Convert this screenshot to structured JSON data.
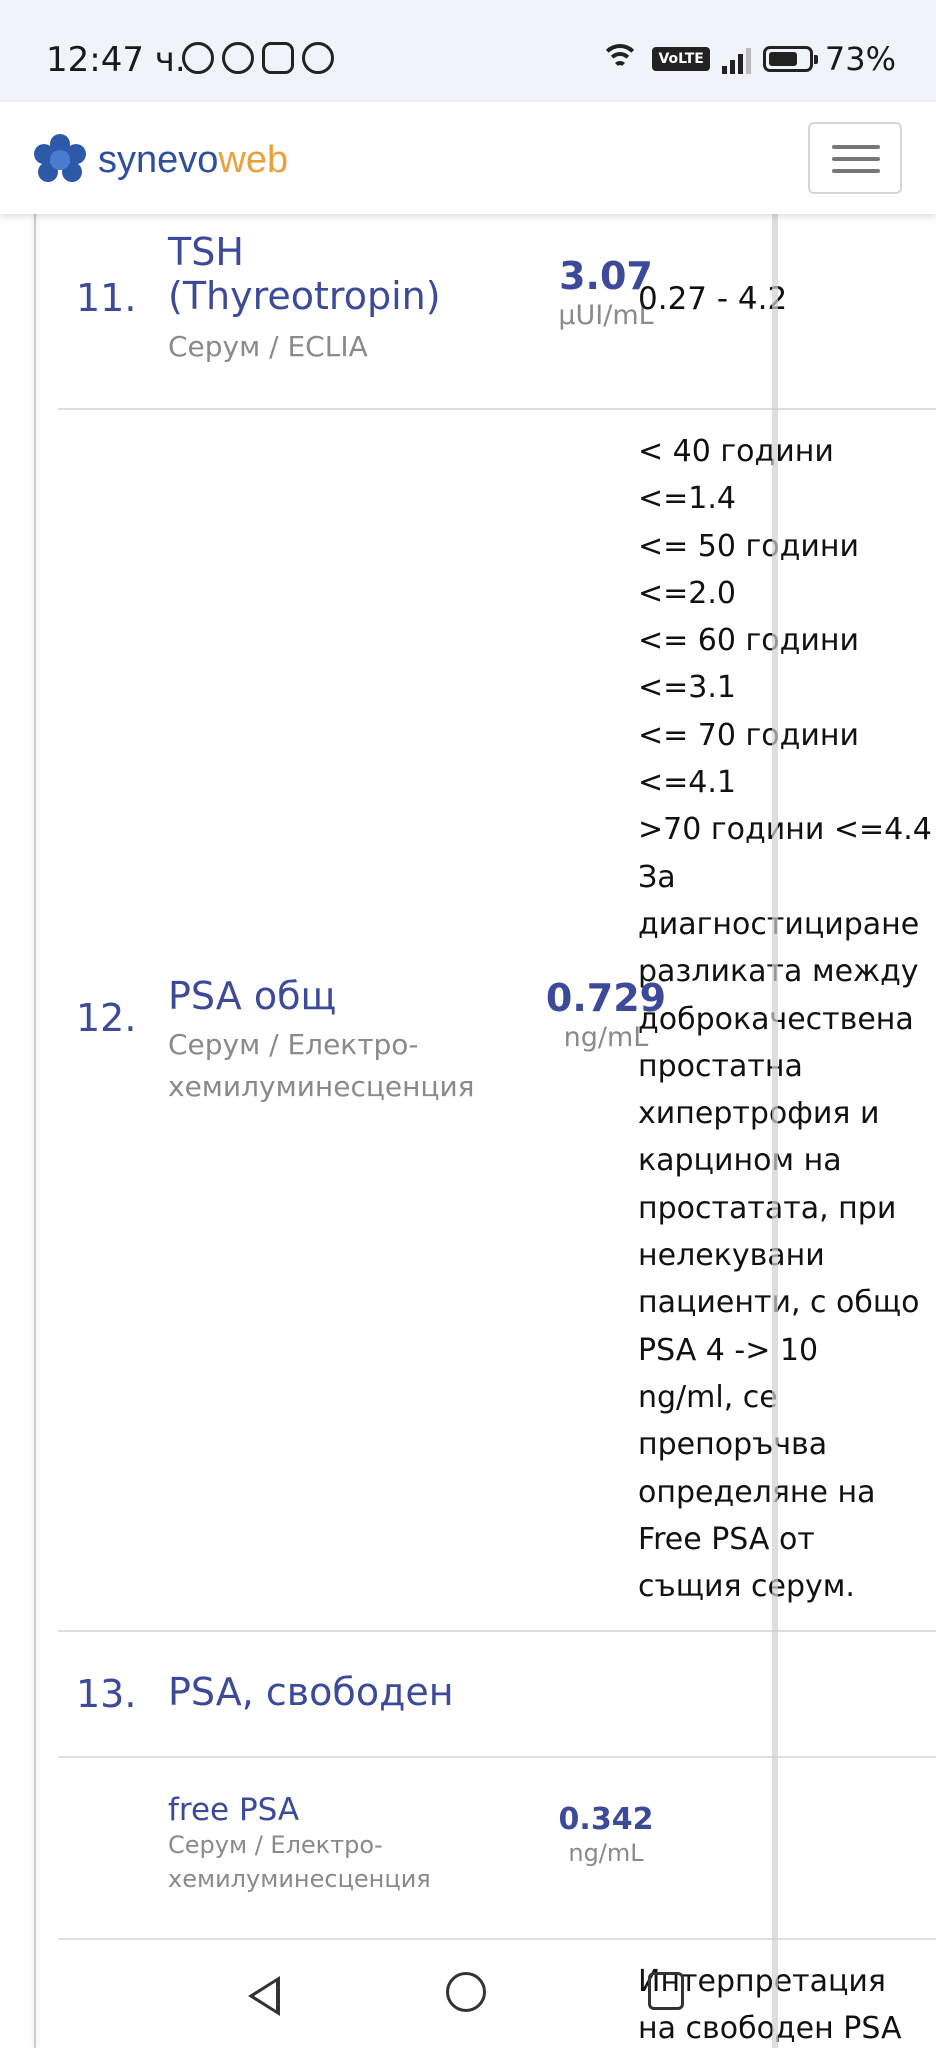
{
  "status_bar": {
    "time": "12:47 ч.",
    "left_icons": [
      "alarm-icon",
      "viber-icon",
      "instagram-icon",
      "hand-icon"
    ],
    "network": "VoLTE",
    "battery": "73%",
    "battery_level": 0.73
  },
  "navbar": {
    "logo_part1": "synevo",
    "logo_part2": "web",
    "menu_icon": "hamburger-icon",
    "colors": {
      "brand_blue": "#2d4f9e",
      "brand_orange": "#e9a23b"
    }
  },
  "results": [
    {
      "number": "11.",
      "name_lines": [
        "TSH",
        "(Thyreotropin)"
      ],
      "sample": "Серум / ECLIA",
      "value": "3.07",
      "unit": "µUI/mL",
      "reference": [
        "0.27 - 4.2"
      ]
    },
    {
      "number": "12.",
      "name": "PSA общ",
      "sample_lines": [
        "Серум / Електро-",
        "хемилуминесценция"
      ],
      "value": "0.729",
      "unit": "ng/mL",
      "reference": [
        "< 40 години",
        "<=1.4",
        "<= 50 години",
        "<=2.0",
        "<= 60 години",
        "<=3.1",
        "<= 70 години",
        "<=4.1",
        ">70 години <=4.4",
        "За",
        "диагностициране",
        "разликата между",
        "доброкачествена",
        "простатна",
        "хипертрофия и",
        "карцином на",
        "простатата, при",
        "нелекувани",
        "пациенти, с общо",
        "PSA 4 -> 10",
        "ng/ml, се",
        "препоръчва",
        "определяне на",
        "Free PSA от",
        "същия серум."
      ]
    },
    {
      "number": "13.",
      "name": "PSA, свободен"
    },
    {
      "number": "",
      "name": "free PSA",
      "sample_lines": [
        "Серум / Електро-",
        "хемилуминесценция"
      ],
      "value": "0.342",
      "unit": "ng/mL"
    },
    {
      "number": "",
      "reference": [
        "Интерпретация",
        "на свободен PSA"
      ]
    }
  ],
  "system_nav": {
    "back": "back-icon",
    "home": "home-icon",
    "recents": "recents-icon"
  }
}
